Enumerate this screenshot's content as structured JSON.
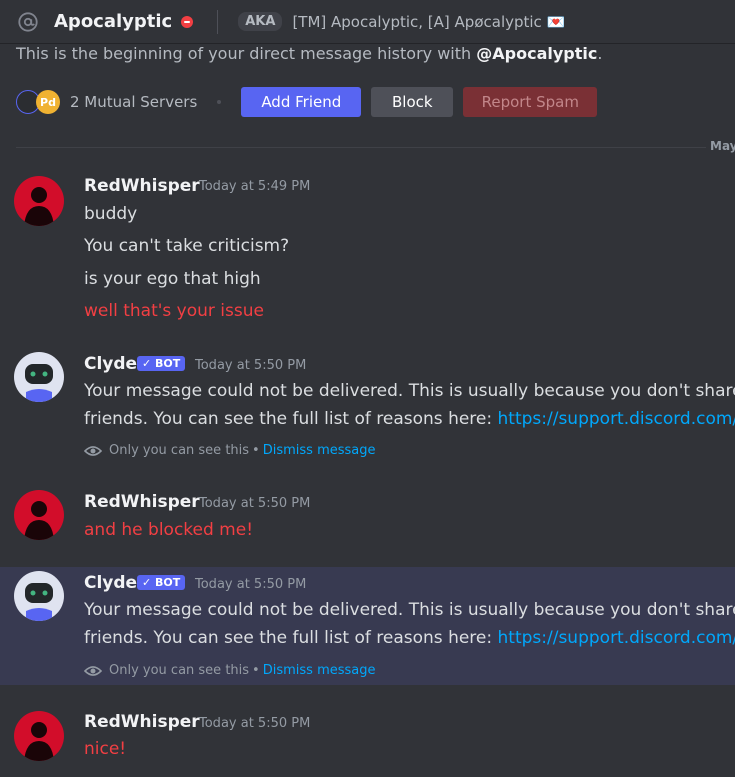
{
  "header": {
    "name": "Apocalyptic",
    "aka_label": "AKA",
    "aka_names": "[TM] Apocalyptic, [A] Apøcalyptic 💌"
  },
  "intro": {
    "prefix": "This is the beginning of your direct message history with",
    "handle": "@Apocalyptic",
    "suffix": "."
  },
  "mutual": {
    "label": "2 Mutual Servers",
    "server_icon2_text": "Pd"
  },
  "actions": {
    "add_friend": "Add Friend",
    "block": "Block",
    "report_spam": "Report Spam"
  },
  "divider_date": "May",
  "messages": [
    {
      "author": "RedWhisper",
      "timestamp": "Today at 5:49 PM",
      "lines": [
        "buddy",
        "You can't take criticism?",
        "is your ego that high",
        "well that's your issue"
      ]
    },
    {
      "author": "Clyde",
      "badge": "✓ BOT",
      "timestamp": "Today at 5:50 PM",
      "line1": "Your message could not be delivered. This is usually because you don't share a",
      "line2_prefix": "friends. You can see the full list of reasons here: ",
      "link": "https://support.discord.com/hc",
      "ephemeral": "Only you can see this",
      "sep": "•",
      "dismiss": "Dismiss message"
    },
    {
      "author": "RedWhisper",
      "timestamp": "Today at 5:50 PM",
      "lines": [
        "and he blocked me!"
      ]
    },
    {
      "author": "Clyde",
      "badge": "✓ BOT",
      "timestamp": "Today at 5:50 PM",
      "line1": "Your message could not be delivered. This is usually because you don't share a",
      "line2_prefix": "friends. You can see the full list of reasons here: ",
      "link": "https://support.discord.com/hc",
      "ephemeral": "Only you can see this",
      "sep": "•",
      "dismiss": "Dismiss message"
    },
    {
      "author": "RedWhisper",
      "timestamp": "Today at 5:50 PM",
      "lines": [
        "nice!"
      ]
    }
  ],
  "colors": {
    "background": "#313338",
    "accent": "#5865f2",
    "error_red": "#f23f43",
    "link": "#00a8fc",
    "highlight": "#383a51"
  }
}
